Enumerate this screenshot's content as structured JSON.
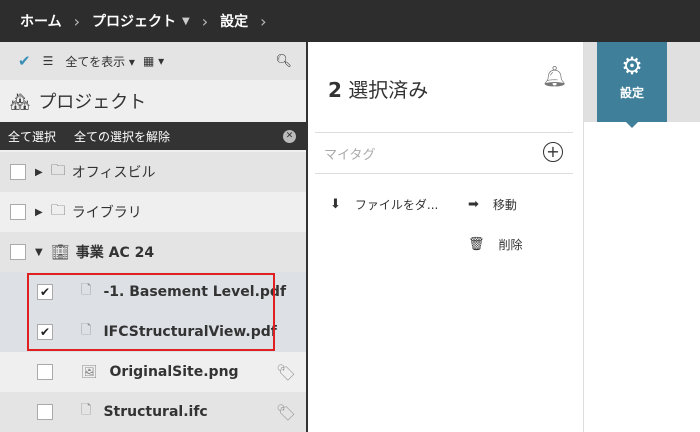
{
  "breadcrumb": [
    "ホーム",
    "プロジェクト",
    "設定"
  ],
  "toolbar": {
    "filter_label": "全てを表示"
  },
  "panel_title": "プロジェクト",
  "selection_bar": {
    "select_all": "全て選択",
    "deselect_all": "全ての選択を解除"
  },
  "tree": [
    {
      "name": "オフィスビル",
      "checked": false
    },
    {
      "name": "ライブラリ",
      "checked": false
    },
    {
      "name": "事業 AC 24",
      "checked": false
    },
    {
      "name": "-1. Basement Level.pdf",
      "checked": true
    },
    {
      "name": "IFCStructuralView.pdf",
      "checked": true
    },
    {
      "name": "OriginalSite.png",
      "checked": false
    },
    {
      "name": "Structural.ifc",
      "checked": false
    }
  ],
  "details": {
    "count": "2",
    "selected_label": "選択済み",
    "my_tags": "マイタグ",
    "download": "ファイルをダ...",
    "move": "移動",
    "delete": "削除"
  },
  "settings_tile": "設定",
  "colors": {
    "accent": "#3f7f9a",
    "highlight": "#e02020"
  }
}
